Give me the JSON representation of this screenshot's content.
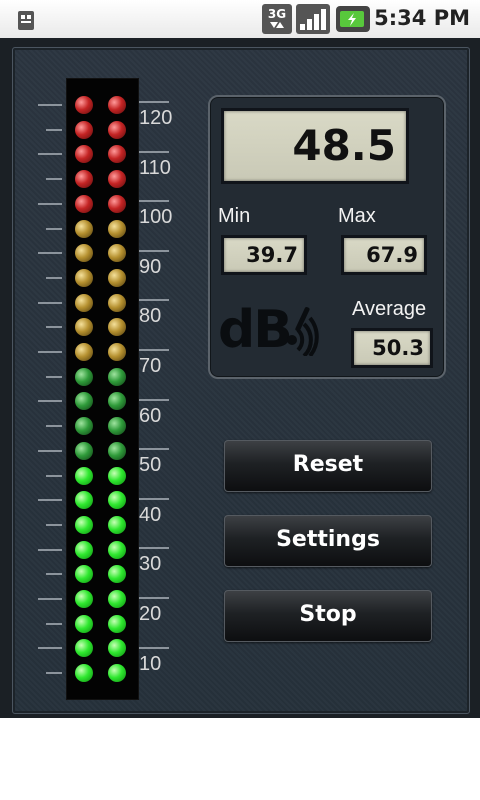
{
  "status_bar": {
    "network_label": "3G",
    "time": "5:34 PM",
    "icons": [
      "notification-icon",
      "network-3g-icon",
      "signal-icon",
      "battery-icon"
    ]
  },
  "meter": {
    "scale_labels": [
      "120",
      "110",
      "100",
      "90",
      "80",
      "70",
      "60",
      "50",
      "40",
      "30",
      "20",
      "10"
    ],
    "led_rows_total": 24,
    "lit_green_rows": 9,
    "colors": {
      "red": "#c42424",
      "yellow": "#b5902f",
      "dim_green": "#2f9b3a",
      "bright_green": "#2fe82f"
    }
  },
  "display": {
    "current_value": "48.5",
    "min_label": "Min",
    "min_value": "39.7",
    "max_label": "Max",
    "max_value": "67.9",
    "average_label": "Average",
    "average_value": "50.3",
    "logo_text": "dB"
  },
  "buttons": {
    "reset": "Reset",
    "settings": "Settings",
    "stop": "Stop"
  }
}
